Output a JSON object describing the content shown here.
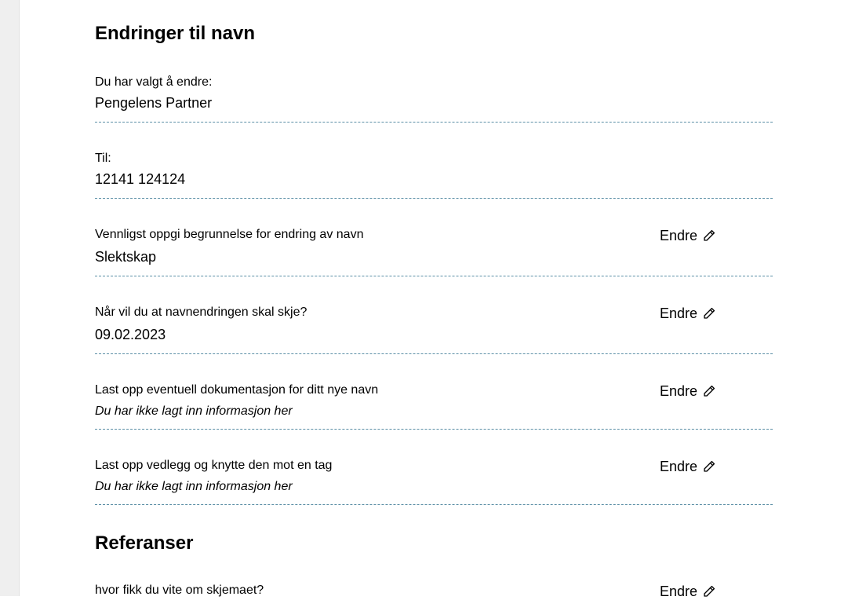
{
  "sections": [
    {
      "title": "Endringer til navn",
      "rows": [
        {
          "label": "Du har valgt å endre:",
          "value": "Pengelens Partner"
        },
        {
          "label": "Til:",
          "value": "12141 124124"
        },
        {
          "label": "Vennligst oppgi begrunnelse for endring av navn",
          "value": "Slektskap",
          "edit_label": "Endre"
        },
        {
          "label": "Når vil du at navnendringen skal skje?",
          "value": "09.02.2023",
          "edit_label": "Endre"
        },
        {
          "label": "Last opp eventuell dokumentasjon for ditt nye navn",
          "value": "Du har ikke lagt inn informasjon her",
          "edit_label": "Endre"
        },
        {
          "label": "Last opp vedlegg og knytte den mot en tag",
          "value": "Du har ikke lagt inn informasjon her",
          "edit_label": "Endre"
        }
      ]
    },
    {
      "title": "Referanser",
      "rows": [
        {
          "label": "hvor fikk du vite om skjemaet?",
          "edit_label": "Endre"
        }
      ]
    }
  ],
  "icons": {
    "edit": "pencil-icon"
  },
  "colors": {
    "divider": "#5b8fa6",
    "gutter": "#efefef"
  }
}
